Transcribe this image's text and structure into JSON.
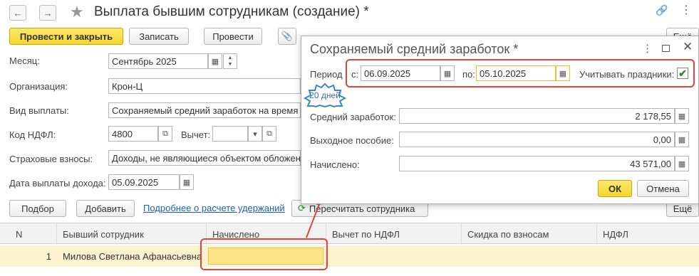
{
  "window": {
    "title": "Выплата бывшим сотрудникам (создание) *"
  },
  "toolbar": {
    "post_close": "Провести и закрыть",
    "save": "Записать",
    "post": "Провести",
    "more": "Ещё"
  },
  "form": {
    "month_label": "Месяц:",
    "month_value": "Сентябрь 2025",
    "org_label": "Организация:",
    "org_value": "Крон-Ц",
    "payment_type_label": "Вид выплаты:",
    "payment_type_value": "Сохраняемый средний заработок на время т",
    "ndfl_code_label": "Код НДФЛ:",
    "ndfl_code_value": "4800",
    "deduction_label": "Вычет:",
    "deduction_value": "",
    "insurance_label": "Страховые взносы:",
    "insurance_value": "Доходы, не являющиеся объектом обложен",
    "income_date_label": "Дата выплаты дохода:",
    "income_date_value": "05.09.2025"
  },
  "table_toolbar": {
    "select": "Подбор",
    "add": "Добавить",
    "details_link": "Подробнее о расчете удержаний",
    "recalc": "Пересчитать сотрудника"
  },
  "grid": {
    "headers": [
      "N",
      "Бывший сотрудник",
      "Начислено",
      "Вычет по НДФЛ",
      "Скидка по взносам",
      "НДФЛ"
    ],
    "rows": [
      {
        "n": "1",
        "employee": "Милова Светлана Афанасьевна",
        "accrued": "",
        "deduction": "",
        "discount": "",
        "ndfl": ""
      }
    ]
  },
  "dialog": {
    "title": "Сохраняемый средний заработок *",
    "period_label": "Период",
    "from_label": "с:",
    "from_value": "06.09.2025",
    "to_label": "по:",
    "to_value": "05.10.2025",
    "holidays_label": "Учитывать праздники:",
    "holidays_checked": true,
    "days_badge": "20 дней",
    "avg_label": "Средний заработок:",
    "avg_value": "2 178,55",
    "severance_label": "Выходное пособие:",
    "severance_value": "0,00",
    "accrued_label": "Начислено:",
    "accrued_value": "43 571,00",
    "ok": "ОК",
    "cancel": "Отмена"
  },
  "colors": {
    "accent_yellow": "#f6d52c",
    "highlight_red": "#e0443a",
    "link_blue": "#1a5fb4",
    "row_highlight": "#fbf3cf"
  }
}
